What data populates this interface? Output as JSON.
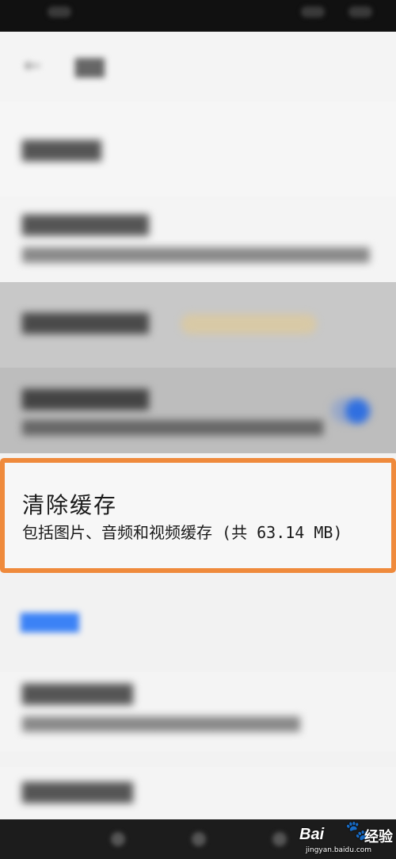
{
  "app_bar": {
    "back_icon": "arrow-left-icon"
  },
  "clear_cache": {
    "title": "清除缓存",
    "description": "包括图片、音频和视频缓存 (共 63.14 MB)"
  },
  "toggle": {
    "on": true,
    "accent": "#2f6fe0"
  },
  "highlight_color": "#ef8a3c",
  "watermark": {
    "brand": "Bai",
    "paw_icon": "paw-icon",
    "brand_suffix": "经验",
    "url": "jingyan.baidu.com"
  }
}
